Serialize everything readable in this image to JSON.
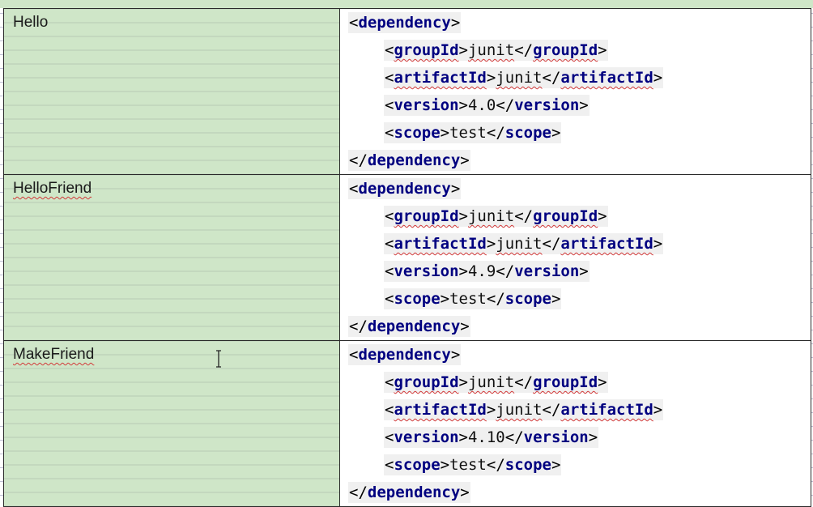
{
  "rows": [
    {
      "name": "Hello",
      "name_misspelled": false,
      "open_tag": "dependency",
      "group_id_tag": "groupId",
      "group_id": "junit",
      "artifact_id_tag": "artifactId",
      "artifact_id": "junit",
      "version_tag": "version",
      "version": "4.0",
      "scope_tag": "scope",
      "scope": "test"
    },
    {
      "name": "HelloFriend",
      "name_misspelled": true,
      "open_tag": "dependency",
      "group_id_tag": "groupId",
      "group_id": "junit",
      "artifact_id_tag": "artifactId",
      "artifact_id": "junit",
      "version_tag": "version",
      "version": "4.9",
      "scope_tag": "scope",
      "scope": "test"
    },
    {
      "name": "MakeFriend",
      "name_misspelled": true,
      "open_tag": "dependency",
      "group_id_tag": "groupId",
      "group_id": "junit",
      "artifact_id_tag": "artifactId",
      "artifact_id": "junit",
      "version_tag": "version",
      "version": "4.10",
      "scope_tag": "scope",
      "scope": "test"
    }
  ],
  "colors": {
    "name_cell_bg": "#cfe6c8",
    "tag_color": "#000080",
    "spellcheck": "#d23a3a"
  },
  "icons": {
    "cursor": "text-cursor-icon"
  }
}
